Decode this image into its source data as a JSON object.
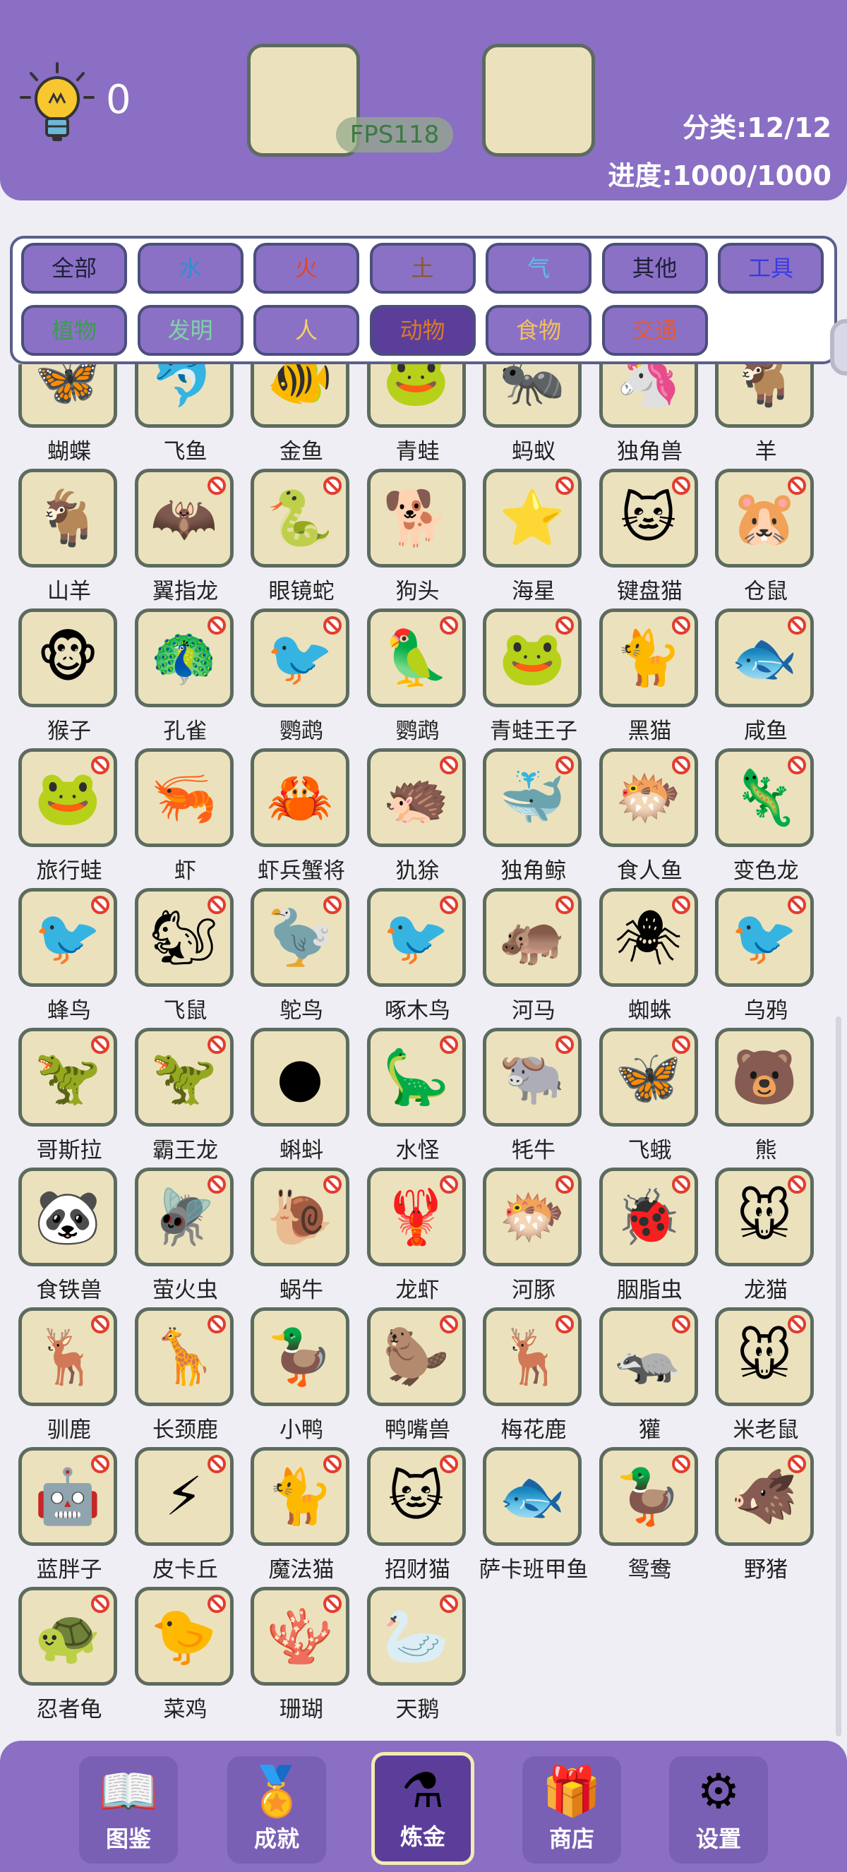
{
  "header": {
    "hint_count": "0",
    "fps": "FPS118",
    "category_progress": "分类:12/12",
    "overall_progress": "进度:1000/1000"
  },
  "filters": [
    {
      "label": "全部",
      "color": "#1f1f3a"
    },
    {
      "label": "水",
      "color": "#2d8fd0"
    },
    {
      "label": "火",
      "color": "#e0462e"
    },
    {
      "label": "土",
      "color": "#8c5a2b"
    },
    {
      "label": "气",
      "color": "#5fbde6"
    },
    {
      "label": "其他",
      "color": "#1f1f3a"
    },
    {
      "label": "工具",
      "color": "#3a3ae0"
    },
    {
      "label": "植物",
      "color": "#3d9a52"
    },
    {
      "label": "发明",
      "color": "#7ed3a4"
    },
    {
      "label": "人",
      "color": "#f4d35e"
    },
    {
      "label": "动物",
      "color": "#d97a2c",
      "active": true
    },
    {
      "label": "食物",
      "color": "#f0c060"
    },
    {
      "label": "交通",
      "color": "#e05a3c"
    }
  ],
  "items": [
    {
      "name": "蝴蝶",
      "icon": "🦋",
      "banned": false
    },
    {
      "name": "飞鱼",
      "icon": "🐬",
      "banned": true
    },
    {
      "name": "金鱼",
      "icon": "🐠",
      "banned": false
    },
    {
      "name": "青蛙",
      "icon": "🐸",
      "banned": false
    },
    {
      "name": "蚂蚁",
      "icon": "🐜",
      "banned": false
    },
    {
      "name": "独角兽",
      "icon": "🦄",
      "banned": false
    },
    {
      "name": "羊",
      "icon": "🐐",
      "banned": false
    },
    {
      "name": "山羊",
      "icon": "🐐",
      "banned": false
    },
    {
      "name": "翼指龙",
      "icon": "🦇",
      "banned": true
    },
    {
      "name": "眼镜蛇",
      "icon": "🐍",
      "banned": true
    },
    {
      "name": "狗头",
      "icon": "🐕",
      "banned": false
    },
    {
      "name": "海星",
      "icon": "⭐",
      "banned": true
    },
    {
      "name": "键盘猫",
      "icon": "🐱",
      "banned": true
    },
    {
      "name": "仓鼠",
      "icon": "🐹",
      "banned": true
    },
    {
      "name": "猴子",
      "icon": "🐵",
      "banned": false
    },
    {
      "name": "孔雀",
      "icon": "🦚",
      "banned": true
    },
    {
      "name": "鹦鹉",
      "icon": "🐦",
      "banned": true
    },
    {
      "name": "鹦鹉",
      "icon": "🦜",
      "banned": true
    },
    {
      "name": "青蛙王子",
      "icon": "🐸",
      "banned": true
    },
    {
      "name": "黑猫",
      "icon": "🐈",
      "banned": true
    },
    {
      "name": "咸鱼",
      "icon": "🐟",
      "banned": true
    },
    {
      "name": "旅行蛙",
      "icon": "🐸",
      "banned": true
    },
    {
      "name": "虾",
      "icon": "🦐",
      "banned": false
    },
    {
      "name": "虾兵蟹将",
      "icon": "🦀",
      "banned": false
    },
    {
      "name": "犰狳",
      "icon": "🦔",
      "banned": true
    },
    {
      "name": "独角鲸",
      "icon": "🐳",
      "banned": true
    },
    {
      "name": "食人鱼",
      "icon": "🐡",
      "banned": true
    },
    {
      "name": "变色龙",
      "icon": "🦎",
      "banned": true
    },
    {
      "name": "蜂鸟",
      "icon": "🐦",
      "banned": true
    },
    {
      "name": "飞鼠",
      "icon": "🐿",
      "banned": true
    },
    {
      "name": "鸵鸟",
      "icon": "🦤",
      "banned": true
    },
    {
      "name": "啄木鸟",
      "icon": "🐦",
      "banned": true
    },
    {
      "name": "河马",
      "icon": "🦛",
      "banned": true
    },
    {
      "name": "蜘蛛",
      "icon": "🕷",
      "banned": true
    },
    {
      "name": "乌鸦",
      "icon": "🐦",
      "banned": true
    },
    {
      "name": "哥斯拉",
      "icon": "🦖",
      "banned": true
    },
    {
      "name": "霸王龙",
      "icon": "🦖",
      "banned": true
    },
    {
      "name": "蝌蚪",
      "icon": "●",
      "banned": false
    },
    {
      "name": "水怪",
      "icon": "🦕",
      "banned": true
    },
    {
      "name": "牦牛",
      "icon": "🐃",
      "banned": true
    },
    {
      "name": "飞蛾",
      "icon": "🦋",
      "banned": true
    },
    {
      "name": "熊",
      "icon": "🐻",
      "banned": false
    },
    {
      "name": "食铁兽",
      "icon": "🐼",
      "banned": false
    },
    {
      "name": "萤火虫",
      "icon": "🪰",
      "banned": true
    },
    {
      "name": "蜗牛",
      "icon": "🐌",
      "banned": true
    },
    {
      "name": "龙虾",
      "icon": "🦞",
      "banned": true
    },
    {
      "name": "河豚",
      "icon": "🐡",
      "banned": true
    },
    {
      "name": "胭脂虫",
      "icon": "🐞",
      "banned": true
    },
    {
      "name": "龙猫",
      "icon": "🐭",
      "banned": true
    },
    {
      "name": "驯鹿",
      "icon": "🦌",
      "banned": true
    },
    {
      "name": "长颈鹿",
      "icon": "🦒",
      "banned": true
    },
    {
      "name": "小鸭",
      "icon": "🦆",
      "banned": false
    },
    {
      "name": "鸭嘴兽",
      "icon": "🦫",
      "banned": true
    },
    {
      "name": "梅花鹿",
      "icon": "🦌",
      "banned": true
    },
    {
      "name": "獾",
      "icon": "🦡",
      "banned": true
    },
    {
      "name": "米老鼠",
      "icon": "🐭",
      "banned": true
    },
    {
      "name": "蓝胖子",
      "icon": "🤖",
      "banned": true
    },
    {
      "name": "皮卡丘",
      "icon": "⚡",
      "banned": true
    },
    {
      "name": "魔法猫",
      "icon": "🐈",
      "banned": true
    },
    {
      "name": "招财猫",
      "icon": "🐱",
      "banned": true
    },
    {
      "name": "萨卡班甲鱼",
      "icon": "🐟",
      "banned": false
    },
    {
      "name": "鸳鸯",
      "icon": "🦆",
      "banned": true
    },
    {
      "name": "野猪",
      "icon": "🐗",
      "banned": true
    },
    {
      "name": "忍者龟",
      "icon": "🐢",
      "banned": true
    },
    {
      "name": "菜鸡",
      "icon": "🐤",
      "banned": true
    },
    {
      "name": "珊瑚",
      "icon": "🪸",
      "banned": true
    },
    {
      "name": "天鹅",
      "icon": "🦢",
      "banned": true
    }
  ],
  "nav": [
    {
      "label": "图鉴",
      "icon": "📖",
      "active": false
    },
    {
      "label": "成就",
      "icon": "🏅",
      "active": false
    },
    {
      "label": "炼金",
      "icon": "⚗",
      "active": true
    },
    {
      "label": "商店",
      "icon": "🎁",
      "active": false
    },
    {
      "label": "设置",
      "icon": "⚙",
      "active": false
    }
  ]
}
